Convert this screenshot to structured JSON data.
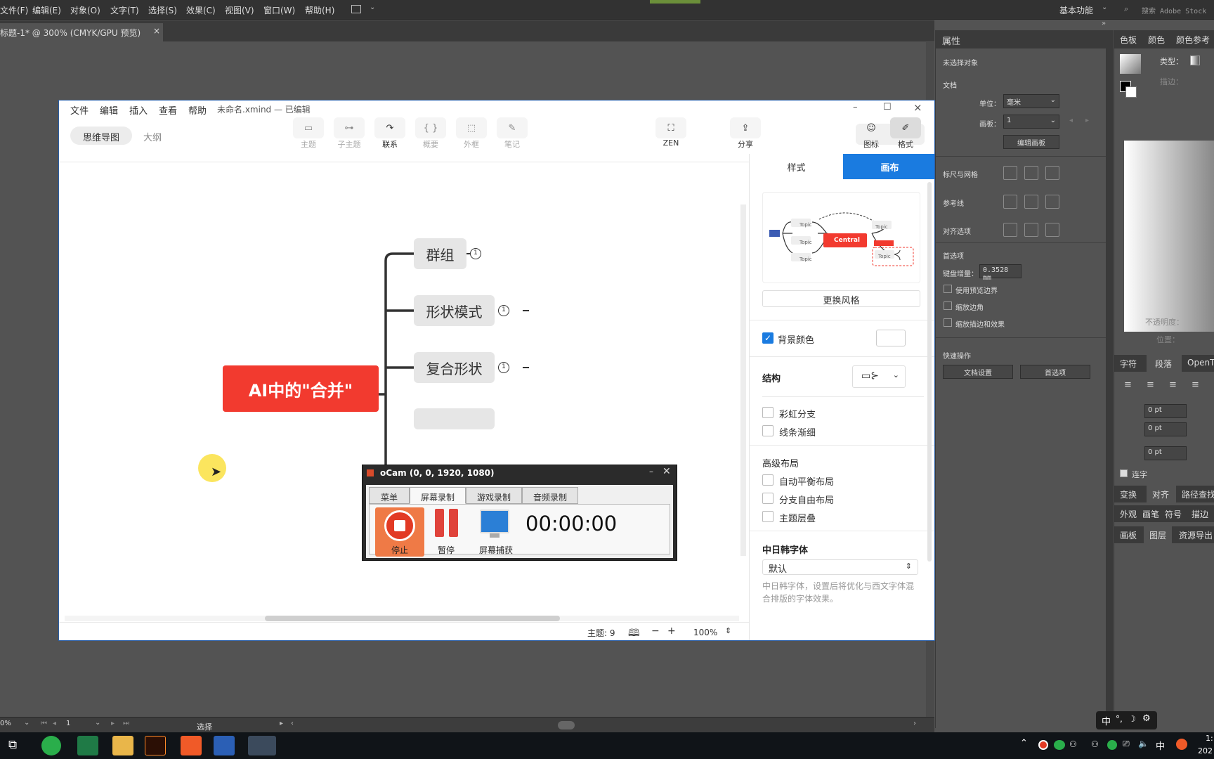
{
  "ai": {
    "menus": [
      "文件(F)",
      "编辑(E)",
      "对象(O)",
      "文字(T)",
      "选择(S)",
      "效果(C)",
      "视图(V)",
      "窗口(W)",
      "帮助(H)"
    ],
    "workspace": "基本功能",
    "search_placeholder": "搜索 Adobe Stock",
    "doc_tab": "标题-1* @ 300% (CMYK/GPU 预览)",
    "status_zoom": "0%",
    "status_artboard": "1",
    "status_tool": "选择"
  },
  "props": {
    "tab": "属性",
    "no_selection": "未选择对象",
    "document": "文档",
    "units_label": "单位：",
    "units_value": "毫米",
    "artboard_label": "画板：",
    "artboard_value": "1",
    "edit_artboard": "编辑画板",
    "rulers_grids": "标尺与网格",
    "guides": "参考线",
    "align_options": "对齐选项",
    "preferences": "首选项",
    "keyboard_increment_label": "键盘增量：",
    "keyboard_increment_value": "0.3528 mm",
    "use_preview_bounds": "使用预览边界",
    "scale_corners": "缩放边角",
    "scale_strokes": "缩放描边和效果",
    "quick_actions": "快速操作",
    "doc_setup": "文档设置",
    "prefs_button": "首选项"
  },
  "right": {
    "tabs_top": [
      "色板",
      "颜色",
      "颜色参考"
    ],
    "type_label": "类型：",
    "stroke_label": "描边：",
    "opacity_label": "不透明度：",
    "position_label": "位置：",
    "tabs_mid": [
      "字符",
      "段落",
      "OpenT"
    ],
    "pt_values": [
      "0 pt",
      "0 pt",
      "0 pt"
    ],
    "ligature": "连字",
    "tabs_low1": [
      "变换",
      "对齐",
      "路径查找"
    ],
    "tabs_low2": [
      "外观",
      "画笔",
      "符号",
      "描边"
    ],
    "tabs_low3": [
      "画板",
      "图层",
      "资源导出"
    ]
  },
  "xmind": {
    "menus": [
      "文件",
      "编辑",
      "插入",
      "查看",
      "帮助"
    ],
    "title": "未命名.xmind — 已编辑",
    "view_tabs": [
      "思维导图",
      "大纲"
    ],
    "tools": [
      "主题",
      "子主题",
      "联系",
      "概要",
      "外框",
      "笔记"
    ],
    "zen": "ZEN",
    "share": "分享",
    "icon_label": "图标",
    "format_label": "格式",
    "central": "AI中的\"合并\"",
    "subtopics": [
      "群组",
      "形状模式",
      "复合形状"
    ],
    "badge": "1",
    "status_topics": "主题: 9",
    "zoom": "100%",
    "side_tabs": [
      "样式",
      "画布"
    ],
    "preview_central": "Central",
    "preview_topic": "Topic",
    "change_style": "更换风格",
    "bg_color": "背景颜色",
    "structure": "结构",
    "rainbow": "彩虹分支",
    "taper": "线条渐细",
    "advanced_layout": "高级布局",
    "auto_balance": "自动平衡布局",
    "free_branch": "分支自由布局",
    "overlap": "主题层叠",
    "cjk_font": "中日韩字体",
    "font_value": "默认",
    "font_desc": "中日韩字体，设置后将优化与西文字体混合排版的字体效果。"
  },
  "ocam": {
    "title": "oCam (0, 0, 1920, 1080)",
    "tabs": [
      "菜单",
      "屏幕录制",
      "游戏录制",
      "音频录制"
    ],
    "stop": "停止",
    "pause": "暂停",
    "capture": "屏幕捕获",
    "timer": "00:00:00"
  },
  "taskbar": {
    "ime": "中",
    "ime_tray": "中",
    "clock_1": "1:",
    "clock_2": "202"
  },
  "colors": {
    "central": "#f23a2f",
    "accent_blue": "#1a7be0",
    "ocam_stop": "#ef7a46"
  }
}
